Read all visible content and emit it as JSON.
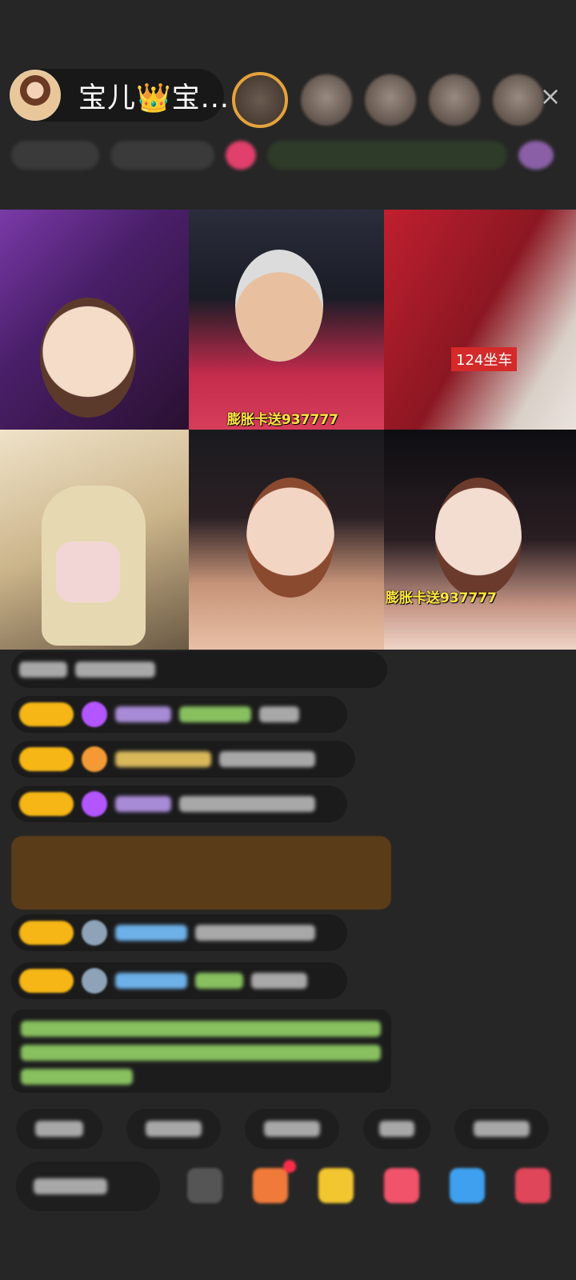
{
  "host": {
    "name": "宝儿👑宝..."
  },
  "close_icon": "×",
  "tiles": [
    {
      "label": "",
      "label_style": "none"
    },
    {
      "label": "膨胀卡送937777",
      "label_style": "yellow"
    },
    {
      "label": "124坐车",
      "label_style": "redbox"
    },
    {
      "label": "",
      "label_style": "none"
    },
    {
      "label": "",
      "label_style": "none"
    },
    {
      "label": "膨胀卡送937777",
      "label_style": "yellow"
    }
  ],
  "colors": {
    "background": "#262626",
    "level_badge": "#f5b616",
    "notice_bg": "#5a3c18",
    "unread_dot": "#ff2d4b"
  }
}
